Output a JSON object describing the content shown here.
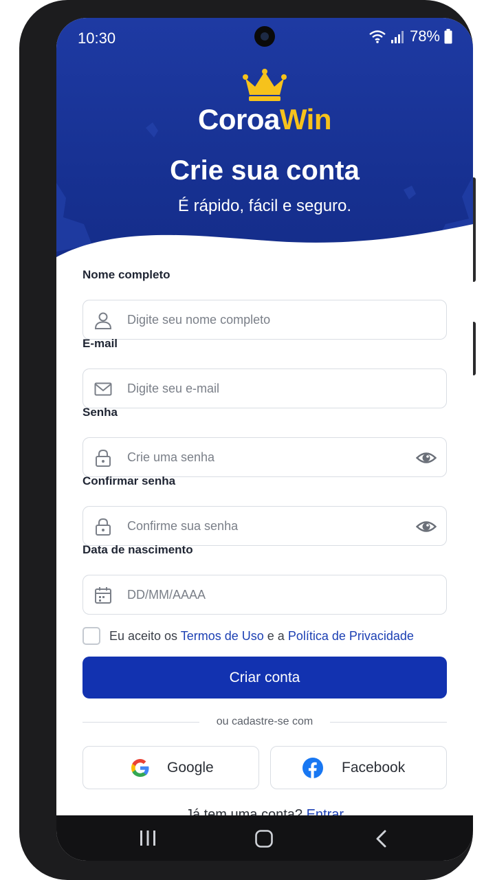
{
  "status_bar": {
    "time": "10:30",
    "battery": "78%",
    "icons": [
      "wifi-icon",
      "signal-icon",
      "battery-icon"
    ]
  },
  "brand": {
    "name_part1": "Coroa",
    "name_part2": "Win",
    "logo_icon": "crown-icon",
    "accent_color": "#f6c21c"
  },
  "hero": {
    "title": "Crie sua conta",
    "subtitle": "É rápido, fácil e seguro.",
    "background_color": "#1a3599"
  },
  "form": {
    "full_name": {
      "label": "Nome completo",
      "placeholder": "Digite seu nome completo",
      "icon": "user-icon"
    },
    "email": {
      "label": "E-mail",
      "placeholder": "Digite seu e-mail",
      "icon": "mail-icon"
    },
    "password": {
      "label": "Senha",
      "placeholder": "Crie uma senha",
      "icon": "lock-icon",
      "toggle_icon": "eye-icon"
    },
    "confirm_password": {
      "label": "Confirmar senha",
      "placeholder": "Confirme sua senha",
      "icon": "lock-icon",
      "toggle_icon": "eye-icon"
    },
    "birth_date": {
      "label": "Data de nascimento",
      "placeholder": "DD/MM/AAAA",
      "icon": "calendar-icon"
    },
    "terms": {
      "prefix": "Eu aceito os ",
      "terms_link": "Termos de Uso",
      "middle": " e a ",
      "privacy_link": "Política de Privacidade",
      "checked": false
    },
    "submit_label": "Criar conta",
    "primary_color": "#1232b0"
  },
  "social": {
    "divider_text": "ou cadastre-se com",
    "google_label": "Google",
    "facebook_label": "Facebook"
  },
  "footer": {
    "question": "Já tem uma conta? ",
    "login_link": "Entrar",
    "link_color": "#1b3fb3"
  },
  "nav_bar": {
    "icons": [
      "recent-apps-icon",
      "home-icon",
      "back-icon"
    ]
  }
}
